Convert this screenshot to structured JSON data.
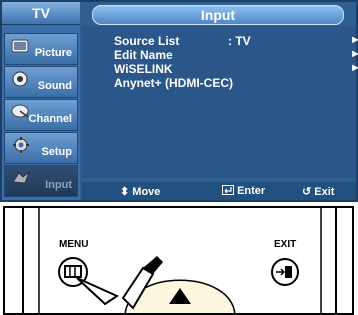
{
  "header": {
    "tv_label": "TV",
    "title": "Input"
  },
  "sidebar": {
    "items": [
      {
        "label": "Picture",
        "icon": "picture-icon"
      },
      {
        "label": "Sound",
        "icon": "sound-icon"
      },
      {
        "label": "Channel",
        "icon": "channel-icon"
      },
      {
        "label": "Setup",
        "icon": "setup-icon"
      },
      {
        "label": "Input",
        "icon": "input-icon",
        "active": true
      }
    ]
  },
  "menu": {
    "items": [
      {
        "label": "Source List",
        "value": ": TV",
        "arrow": "►"
      },
      {
        "label": "Edit Name",
        "arrow": "►"
      },
      {
        "label": "WiSELINK",
        "arrow": "►"
      },
      {
        "label": "Anynet+ (HDMI-CEC)"
      }
    ]
  },
  "footer": {
    "move": "Move",
    "enter": "Enter",
    "exit": "Exit"
  },
  "remote": {
    "menu_label": "MENU",
    "exit_label": "EXIT"
  }
}
